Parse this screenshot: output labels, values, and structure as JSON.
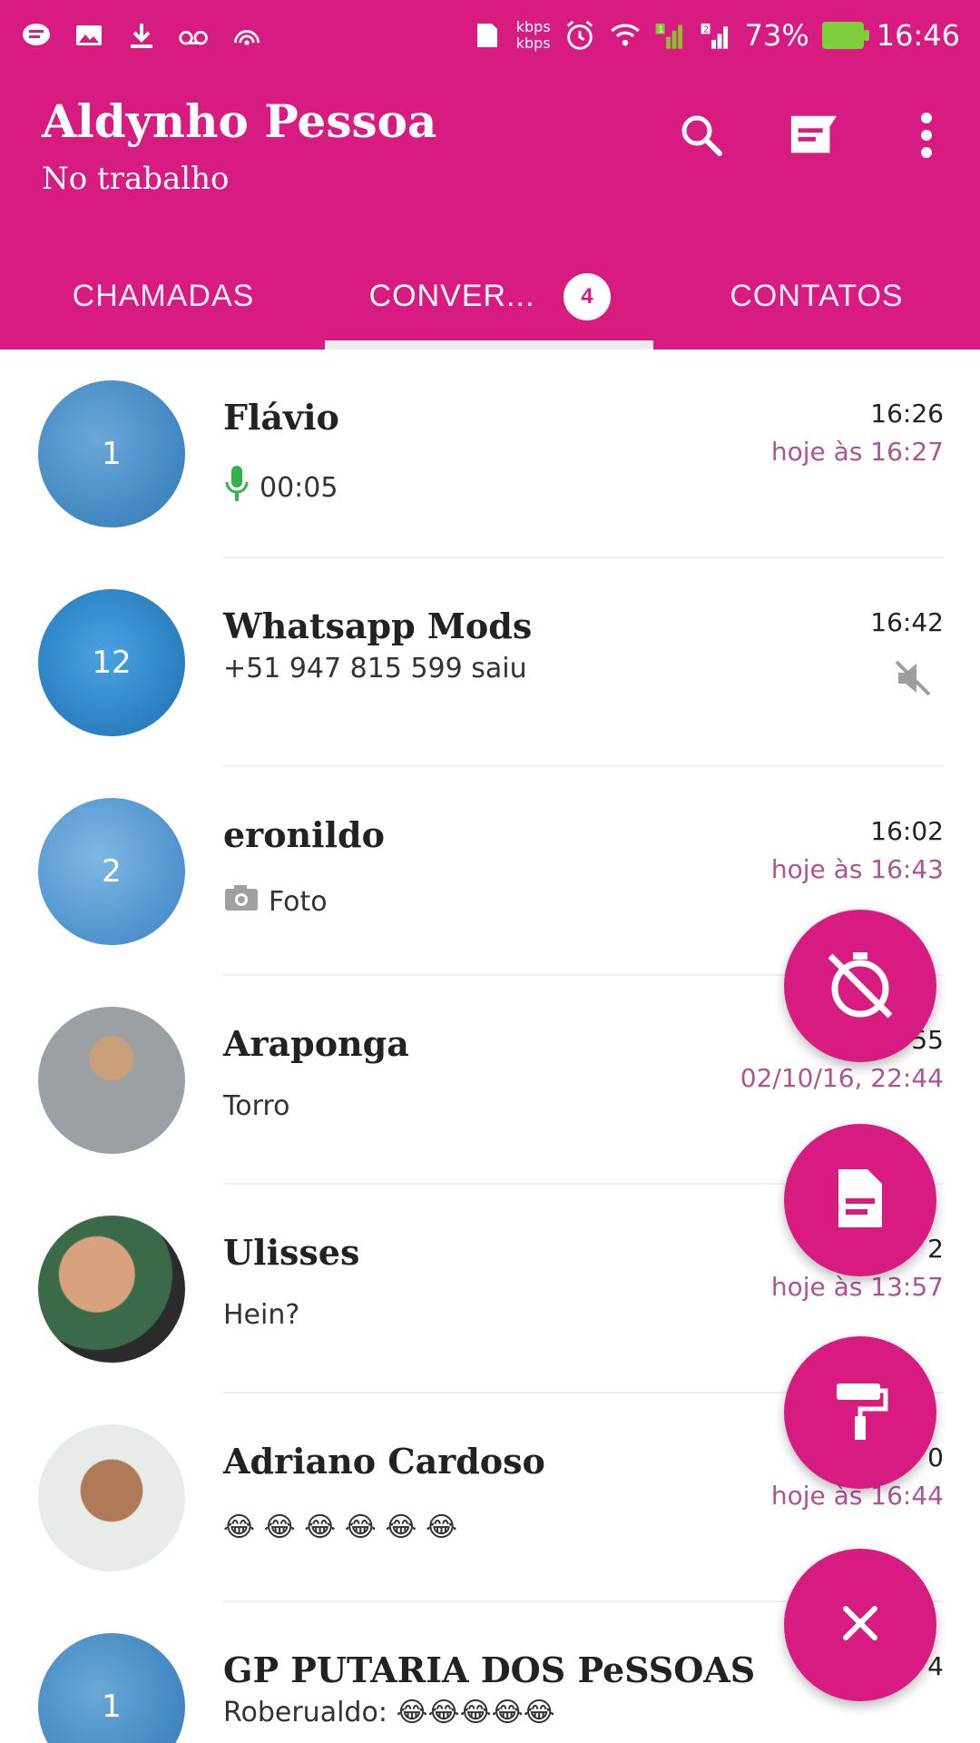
{
  "status_bar": {
    "kbps_top": "kbps",
    "kbps_bottom": "kbps",
    "sim1": "1",
    "sim2": "2",
    "battery_percent": "73%",
    "time": "16:46"
  },
  "header": {
    "title": "Aldynho Pessoa",
    "subtitle": "No trabalho",
    "actions": {
      "search_icon": "search-icon",
      "new_chat_icon": "new-chat-icon",
      "more_icon": "more-vert-icon"
    }
  },
  "tabs": [
    {
      "label": "CHAMADAS"
    },
    {
      "label": "CONVER...",
      "badge": "4"
    },
    {
      "label": "CONTATOS"
    }
  ],
  "colors": {
    "primary": "#d81b81",
    "time_accent": "#b0538f",
    "mic_green": "#34b24a"
  },
  "chats": [
    {
      "name": "Flávio",
      "avatar_count": "1",
      "time": "16:26",
      "sub_time": "hoje às 16:27",
      "preview": "00:05",
      "preview_icon": "mic-icon"
    },
    {
      "name": "Whatsapp Mods",
      "avatar_count": "12",
      "time": "16:42",
      "sub_time": "",
      "preview": "+51 947 815 599 saiu",
      "preview_icon": "",
      "muted": true
    },
    {
      "name": "eronildo",
      "avatar_count": "2",
      "time": "16:02",
      "sub_time": "hoje às 16:43",
      "preview": "Foto",
      "preview_icon": "camera-icon"
    },
    {
      "name": "Araponga",
      "avatar_count": "",
      "time": "55",
      "sub_time": "02/10/16, 22:44",
      "preview": "Torro",
      "preview_icon": ""
    },
    {
      "name": "Ulisses",
      "avatar_count": "",
      "time": "2",
      "sub_time": "hoje às 13:57",
      "preview": "Hein?",
      "preview_icon": ""
    },
    {
      "name": "Adriano Cardoso",
      "avatar_count": "",
      "time": "0",
      "sub_time": "hoje às 16:44",
      "preview": "😂 😂 😂 😂 😂 😂",
      "preview_icon": ""
    },
    {
      "name": "GP PUTARIA DOS  PeSSOAS",
      "avatar_count": "1",
      "time": "4",
      "sub_time": "",
      "preview": "Roberualdo: 😂😂😂😂😂",
      "preview_icon": ""
    }
  ],
  "fabs": {
    "timer_off_icon": "timer-off-icon",
    "document_icon": "document-icon",
    "paint_roller_icon": "paint-roller-icon",
    "close_icon": "close-icon"
  }
}
